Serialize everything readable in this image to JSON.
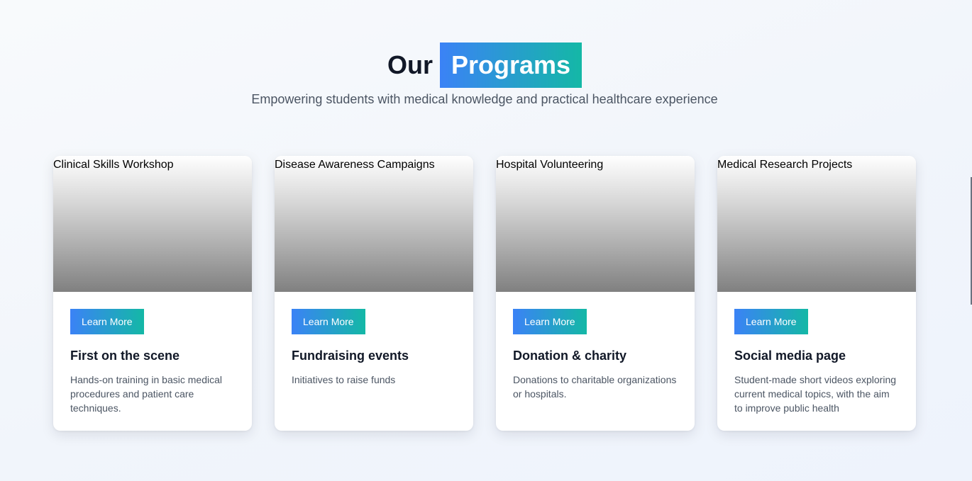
{
  "heading": {
    "title_plain": "Our",
    "title_highlight": "Programs",
    "subtitle": "Empowering students with medical knowledge and practical healthcare experience"
  },
  "colors": {
    "accent_start": "#3b82f6",
    "accent_end": "#14b8a6"
  },
  "programs": [
    {
      "image_alt": "Clinical Skills Workshop",
      "button_label": "Learn More",
      "title": "First on the scene",
      "description": "Hands-on training in basic medical procedures and patient care techniques."
    },
    {
      "image_alt": "Disease Awareness Campaigns",
      "button_label": "Learn More",
      "title": "Fundraising events",
      "description": "Initiatives to raise funds"
    },
    {
      "image_alt": "Hospital Volunteering",
      "button_label": "Learn More",
      "title": "Donation & charity",
      "description": "Donations to charitable organizations or hospitals."
    },
    {
      "image_alt": "Medical Research Projects",
      "button_label": "Learn More",
      "title": "Social media page",
      "description": "Student-made short videos exploring current medical topics, with the aim to improve public health"
    }
  ]
}
